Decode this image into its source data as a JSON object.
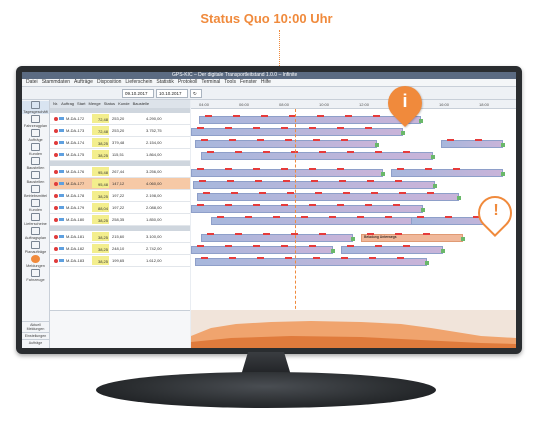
{
  "caption": "Status Quo 10:00 Uhr",
  "app": {
    "title": "GPS-KIC – Der digitale Transportleitstand 1.0.0 – Infinite",
    "menu": [
      "Datei",
      "Stammdaten",
      "Aufträge",
      "Disposition",
      "Lieferschein",
      "Statistik",
      "Protokoll",
      "Terminal",
      "Tools",
      "Fenster",
      "Hilfe"
    ],
    "toolbar": {
      "date_from": "09.10.2017",
      "date_to": "10.10.2017"
    }
  },
  "sidebar": {
    "items": [
      {
        "label": "Tagesgeschäft"
      },
      {
        "label": "Fahrzeugplan"
      },
      {
        "label": "Aufträge"
      },
      {
        "label": "Kunden"
      },
      {
        "label": "Baustellen"
      },
      {
        "label": "Baustellen"
      },
      {
        "label": "Betriebsmittel"
      },
      {
        "label": "Kunden"
      },
      {
        "label": "Lieferscheine"
      },
      {
        "label": "Auftragsplan"
      },
      {
        "label": "Planaufträge"
      },
      {
        "label": "Meldungen"
      },
      {
        "label": "Fahrzeuge"
      }
    ],
    "footer": [
      "Aktuell Meldungen",
      "Einstellungen",
      "Aufträge"
    ]
  },
  "table": {
    "columns": [
      "Nr.",
      "Auftrag",
      "Start",
      "Menge",
      "Status",
      "Kunde",
      "Baustelle"
    ],
    "rows": [
      {
        "id": "M-DA-172",
        "v1": "72,48",
        "v2": "253,20",
        "v3": "4.290,00",
        "v4": ""
      },
      {
        "id": "M-DA-173",
        "v1": "72,48",
        "v2": "253,20",
        "v3": "3.752,75",
        "v4": ""
      },
      {
        "id": "M-DA-174",
        "v1": "38,25",
        "v2": "379,48",
        "v3": "2.154,00",
        "v4": ""
      },
      {
        "id": "M-DA-175",
        "v1": "38,25",
        "v2": "115,51",
        "v3": "1.864,00",
        "v4": ""
      },
      {
        "id": "M-DA-176",
        "v1": "95,48",
        "v2": "267,44",
        "v3": "3.256,00",
        "v4": ""
      },
      {
        "id": "M-DA-177",
        "v1": "95,48",
        "v2": "147,12",
        "v3": "4.060,00",
        "v4": ""
      },
      {
        "id": "M-DA-178",
        "v1": "38,25",
        "v2": "197,22",
        "v3": "2.198,00",
        "v4": ""
      },
      {
        "id": "M-DA-179",
        "v1": "88,04",
        "v2": "197,22",
        "v3": "2.088,00",
        "v4": ""
      },
      {
        "id": "M-DA-180",
        "v1": "38,25",
        "v2": "258,35",
        "v3": "1.850,00",
        "v4": ""
      },
      {
        "id": "M-DA-181",
        "v1": "38,25",
        "v2": "215,60",
        "v3": "3.100,00",
        "v4": ""
      },
      {
        "id": "M-DA-182",
        "v1": "38,25",
        "v2": "248,10",
        "v3": "2.742,00",
        "v4": ""
      },
      {
        "id": "M-DA-183",
        "v1": "38,25",
        "v2": "199,65",
        "v3": "1.612,00",
        "v4": ""
      }
    ]
  },
  "gantt": {
    "timeline": [
      "04:00",
      "06:00",
      "08:00",
      "10:00",
      "12:00",
      "14:00",
      "16:00",
      "18:00"
    ],
    "orange_label": "Beladung Unterwegs"
  },
  "pins": {
    "info_glyph": "i",
    "warning_glyph": "!"
  },
  "colors": {
    "accent": "#f08a3c",
    "bar": "#a7b7dc",
    "alert": "#e53b3b"
  }
}
